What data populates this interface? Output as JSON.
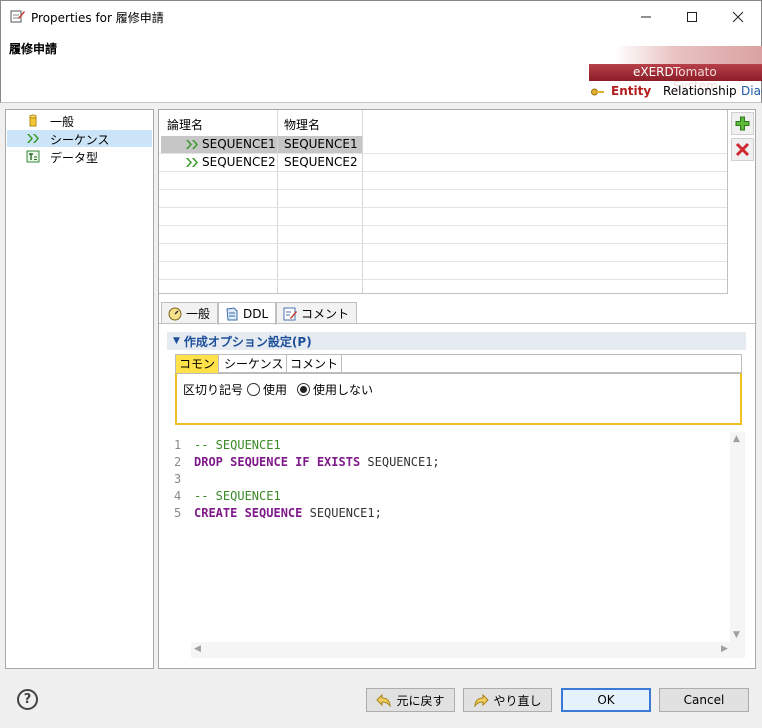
{
  "window": {
    "title": "Properties for 履修申請",
    "controls": [
      "minimize-icon",
      "maximize-icon",
      "close-icon"
    ]
  },
  "header": {
    "page_title": "履修申請",
    "banner": {
      "brand": "eXERD",
      "product": "Tomato System",
      "nav": [
        {
          "label": "Entity",
          "active": true
        },
        {
          "label": "Relationship",
          "active": false
        },
        {
          "label": "Diag",
          "active": false
        }
      ]
    }
  },
  "sidebar": {
    "items": [
      {
        "label": "一般",
        "icon": "cylinder-icon",
        "selected": false
      },
      {
        "label": "シーケンス",
        "icon": "sequence-icon",
        "selected": true
      },
      {
        "label": "データ型",
        "icon": "datatype-icon",
        "selected": false
      }
    ]
  },
  "table": {
    "headers": [
      "論理名",
      "物理名"
    ],
    "rows": [
      {
        "logical": "SEQUENCE1",
        "physical": "SEQUENCE1",
        "selected": true
      },
      {
        "logical": "SEQUENCE2",
        "physical": "SEQUENCE2",
        "selected": false
      }
    ]
  },
  "side_buttons": {
    "add": "plus-icon",
    "delete": "delete-x-icon"
  },
  "tabs": [
    {
      "label": "一般",
      "icon": "gauge-icon",
      "active": false
    },
    {
      "label": "DDL",
      "icon": "ddl-icon",
      "active": true
    },
    {
      "label": "コメント",
      "icon": "comment-icon",
      "active": false
    }
  ],
  "section": {
    "title": "作成オプション設定(P)"
  },
  "subtabs": [
    {
      "label": "コモン",
      "active": true
    },
    {
      "label": "シーケンス",
      "active": false
    },
    {
      "label": "コメント",
      "active": false
    }
  ],
  "options": {
    "delimiter_label": "区切り記号",
    "use_label": "使用",
    "not_use_label": "使用しない",
    "selected": "not_use"
  },
  "ddl": {
    "lines": [
      {
        "n": "1",
        "parts": [
          {
            "t": "-- SEQUENCE1",
            "c": "cm"
          }
        ]
      },
      {
        "n": "2",
        "parts": [
          {
            "t": "DROP SEQUENCE IF EXISTS",
            "c": "kw"
          },
          {
            "t": " SEQUENCE1;",
            "c": "id"
          }
        ]
      },
      {
        "n": "3",
        "parts": []
      },
      {
        "n": "4",
        "parts": [
          {
            "t": "-- SEQUENCE1",
            "c": "cm"
          }
        ]
      },
      {
        "n": "5",
        "parts": [
          {
            "t": "CREATE SEQUENCE",
            "c": "kw"
          },
          {
            "t": " SEQUENCE1;",
            "c": "id"
          }
        ]
      }
    ]
  },
  "footer": {
    "restore_label": "元に戻す",
    "redo_label": "やり直し",
    "ok_label": "OK",
    "cancel_label": "Cancel",
    "help": "?"
  },
  "colors": {
    "accent": "#3b79d6",
    "brand": "#8c1d26",
    "selected_row": "#c6c6c6",
    "tree_selection": "#cce4f7",
    "subtab_active": "#ffe24a",
    "keyword": "#7f1a8a",
    "comment": "#3a8a26"
  }
}
